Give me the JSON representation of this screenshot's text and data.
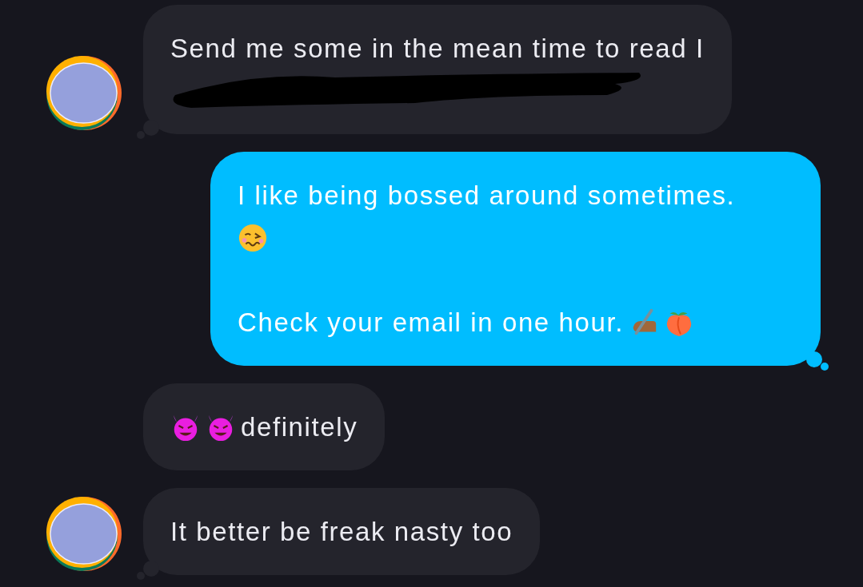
{
  "messages": [
    {
      "kind": "incoming",
      "avatar": true,
      "tail": true,
      "redacted": true,
      "lines": [
        {
          "text": "Send me some in the mean time to read I"
        }
      ]
    },
    {
      "kind": "outgoing",
      "tail": true,
      "redacted": false,
      "lines": [
        {
          "text": "I like being bossed around sometimes."
        },
        {
          "icons": [
            {
              "kind": "woozy"
            }
          ]
        },
        {
          "kind": "blank"
        },
        {
          "text": "Check your email in one hour.",
          "icons": [
            {
              "kind": "writing-hand"
            },
            {
              "kind": "peach"
            }
          ]
        }
      ]
    },
    {
      "kind": "incoming",
      "avatar": false,
      "tail": false,
      "redacted": false,
      "lines": [
        {
          "text": "definitely",
          "icons": [
            {
              "kind": "devil"
            },
            {
              "kind": "devil"
            }
          ],
          "icons_first": true
        }
      ]
    },
    {
      "kind": "incoming",
      "avatar": true,
      "tail": true,
      "redacted": false,
      "lines": [
        {
          "text": "It better be freak nasty too"
        }
      ]
    }
  ]
}
